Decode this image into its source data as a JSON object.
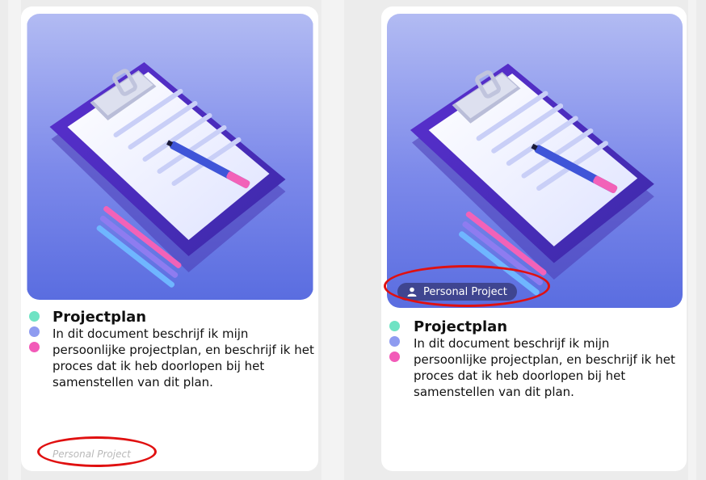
{
  "cards": [
    {
      "title": "Projectplan",
      "description": "In dit document beschrijf ik mijn persoonlijke projectplan, en beschrijf ik het proces dat ik heb doorlopen bij het samenstellen van dit plan.",
      "label": "Personal Project"
    },
    {
      "title": "Projectplan",
      "description": "In dit document beschrijf ik mijn persoonlijke projectplan, en beschrijf ik het proces dat ik heb doorlopen bij het samenstellen van dit plan.",
      "label": "Personal Project",
      "badge_icon": "user-icon"
    }
  ],
  "colors": {
    "dot_1": "#6fe3c4",
    "dot_2": "#8e9bf0",
    "dot_3": "#f25ab8",
    "annotation": "#e01010",
    "badge_bg": "#3f4590"
  }
}
